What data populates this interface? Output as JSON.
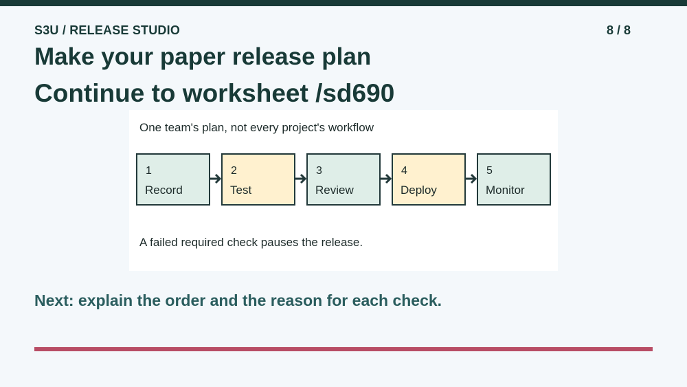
{
  "header": {
    "course_label": "S3U / RELEASE STUDIO",
    "page_counter": "8 / 8"
  },
  "title": {
    "line1": "Make your paper release plan",
    "line2": "Continue to worksheet /sd690"
  },
  "panel": {
    "caption": "One team's plan, not every project's workflow",
    "steps": [
      {
        "number": "1",
        "label": "Record"
      },
      {
        "number": "2",
        "label": "Test"
      },
      {
        "number": "3",
        "label": "Review"
      },
      {
        "number": "4",
        "label": "Deploy"
      },
      {
        "number": "5",
        "label": "Monitor"
      }
    ],
    "note": "A failed required check pauses the release."
  },
  "footer": {
    "next_prompt": "Next: explain the order and the reason for each check."
  },
  "colors": {
    "brand_dark": "#183a37",
    "step_green": "#dfeee8",
    "step_yellow": "#fff1cf",
    "accent_rule": "#b84d65",
    "next_text": "#2a5d5e"
  },
  "icons": {
    "connector": "arrow-right-icon"
  }
}
